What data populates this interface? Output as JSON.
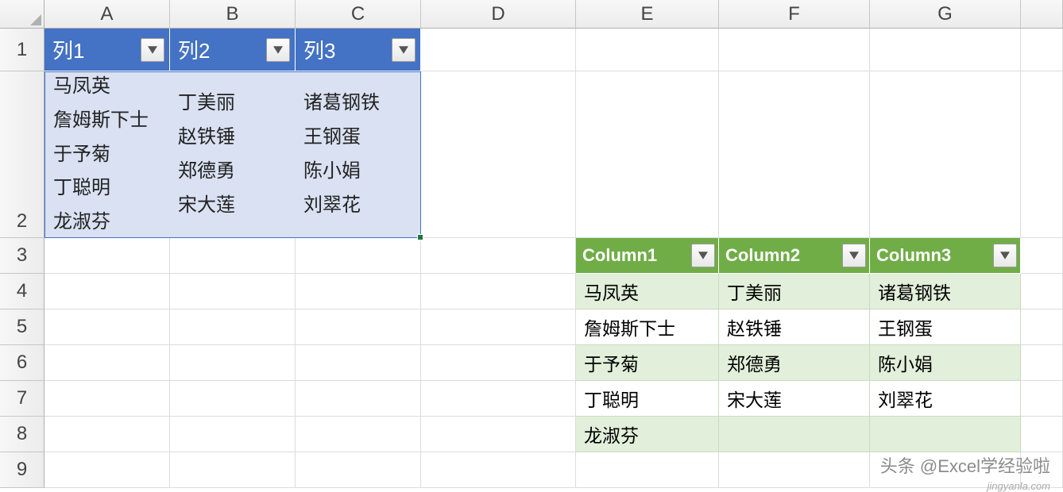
{
  "columns": [
    "A",
    "B",
    "C",
    "D",
    "E",
    "F",
    "G"
  ],
  "rows": [
    "1",
    "2",
    "3",
    "4",
    "5",
    "6",
    "7",
    "8",
    "9"
  ],
  "blue_table": {
    "headers": [
      "列1",
      "列2",
      "列3"
    ],
    "col1": [
      "马凤英",
      "詹姆斯下士",
      "于予菊",
      "丁聪明",
      "龙淑芬"
    ],
    "col2": [
      "丁美丽",
      "赵铁锤",
      "郑德勇",
      "宋大莲"
    ],
    "col3": [
      "诸葛钢铁",
      "王钢蛋",
      "陈小娟",
      "刘翠花"
    ]
  },
  "green_table": {
    "headers": [
      "Column1",
      "Column2",
      "Column3"
    ],
    "rows": [
      [
        "马凤英",
        "丁美丽",
        "诸葛钢铁"
      ],
      [
        "詹姆斯下士",
        "赵铁锤",
        "王钢蛋"
      ],
      [
        "于予菊",
        "郑德勇",
        "陈小娟"
      ],
      [
        "丁聪明",
        "宋大莲",
        "刘翠花"
      ],
      [
        "龙淑芬",
        "",
        ""
      ]
    ]
  },
  "watermark": "头条 @Excel学经验啦",
  "watermark_site": "jingyanla.com"
}
